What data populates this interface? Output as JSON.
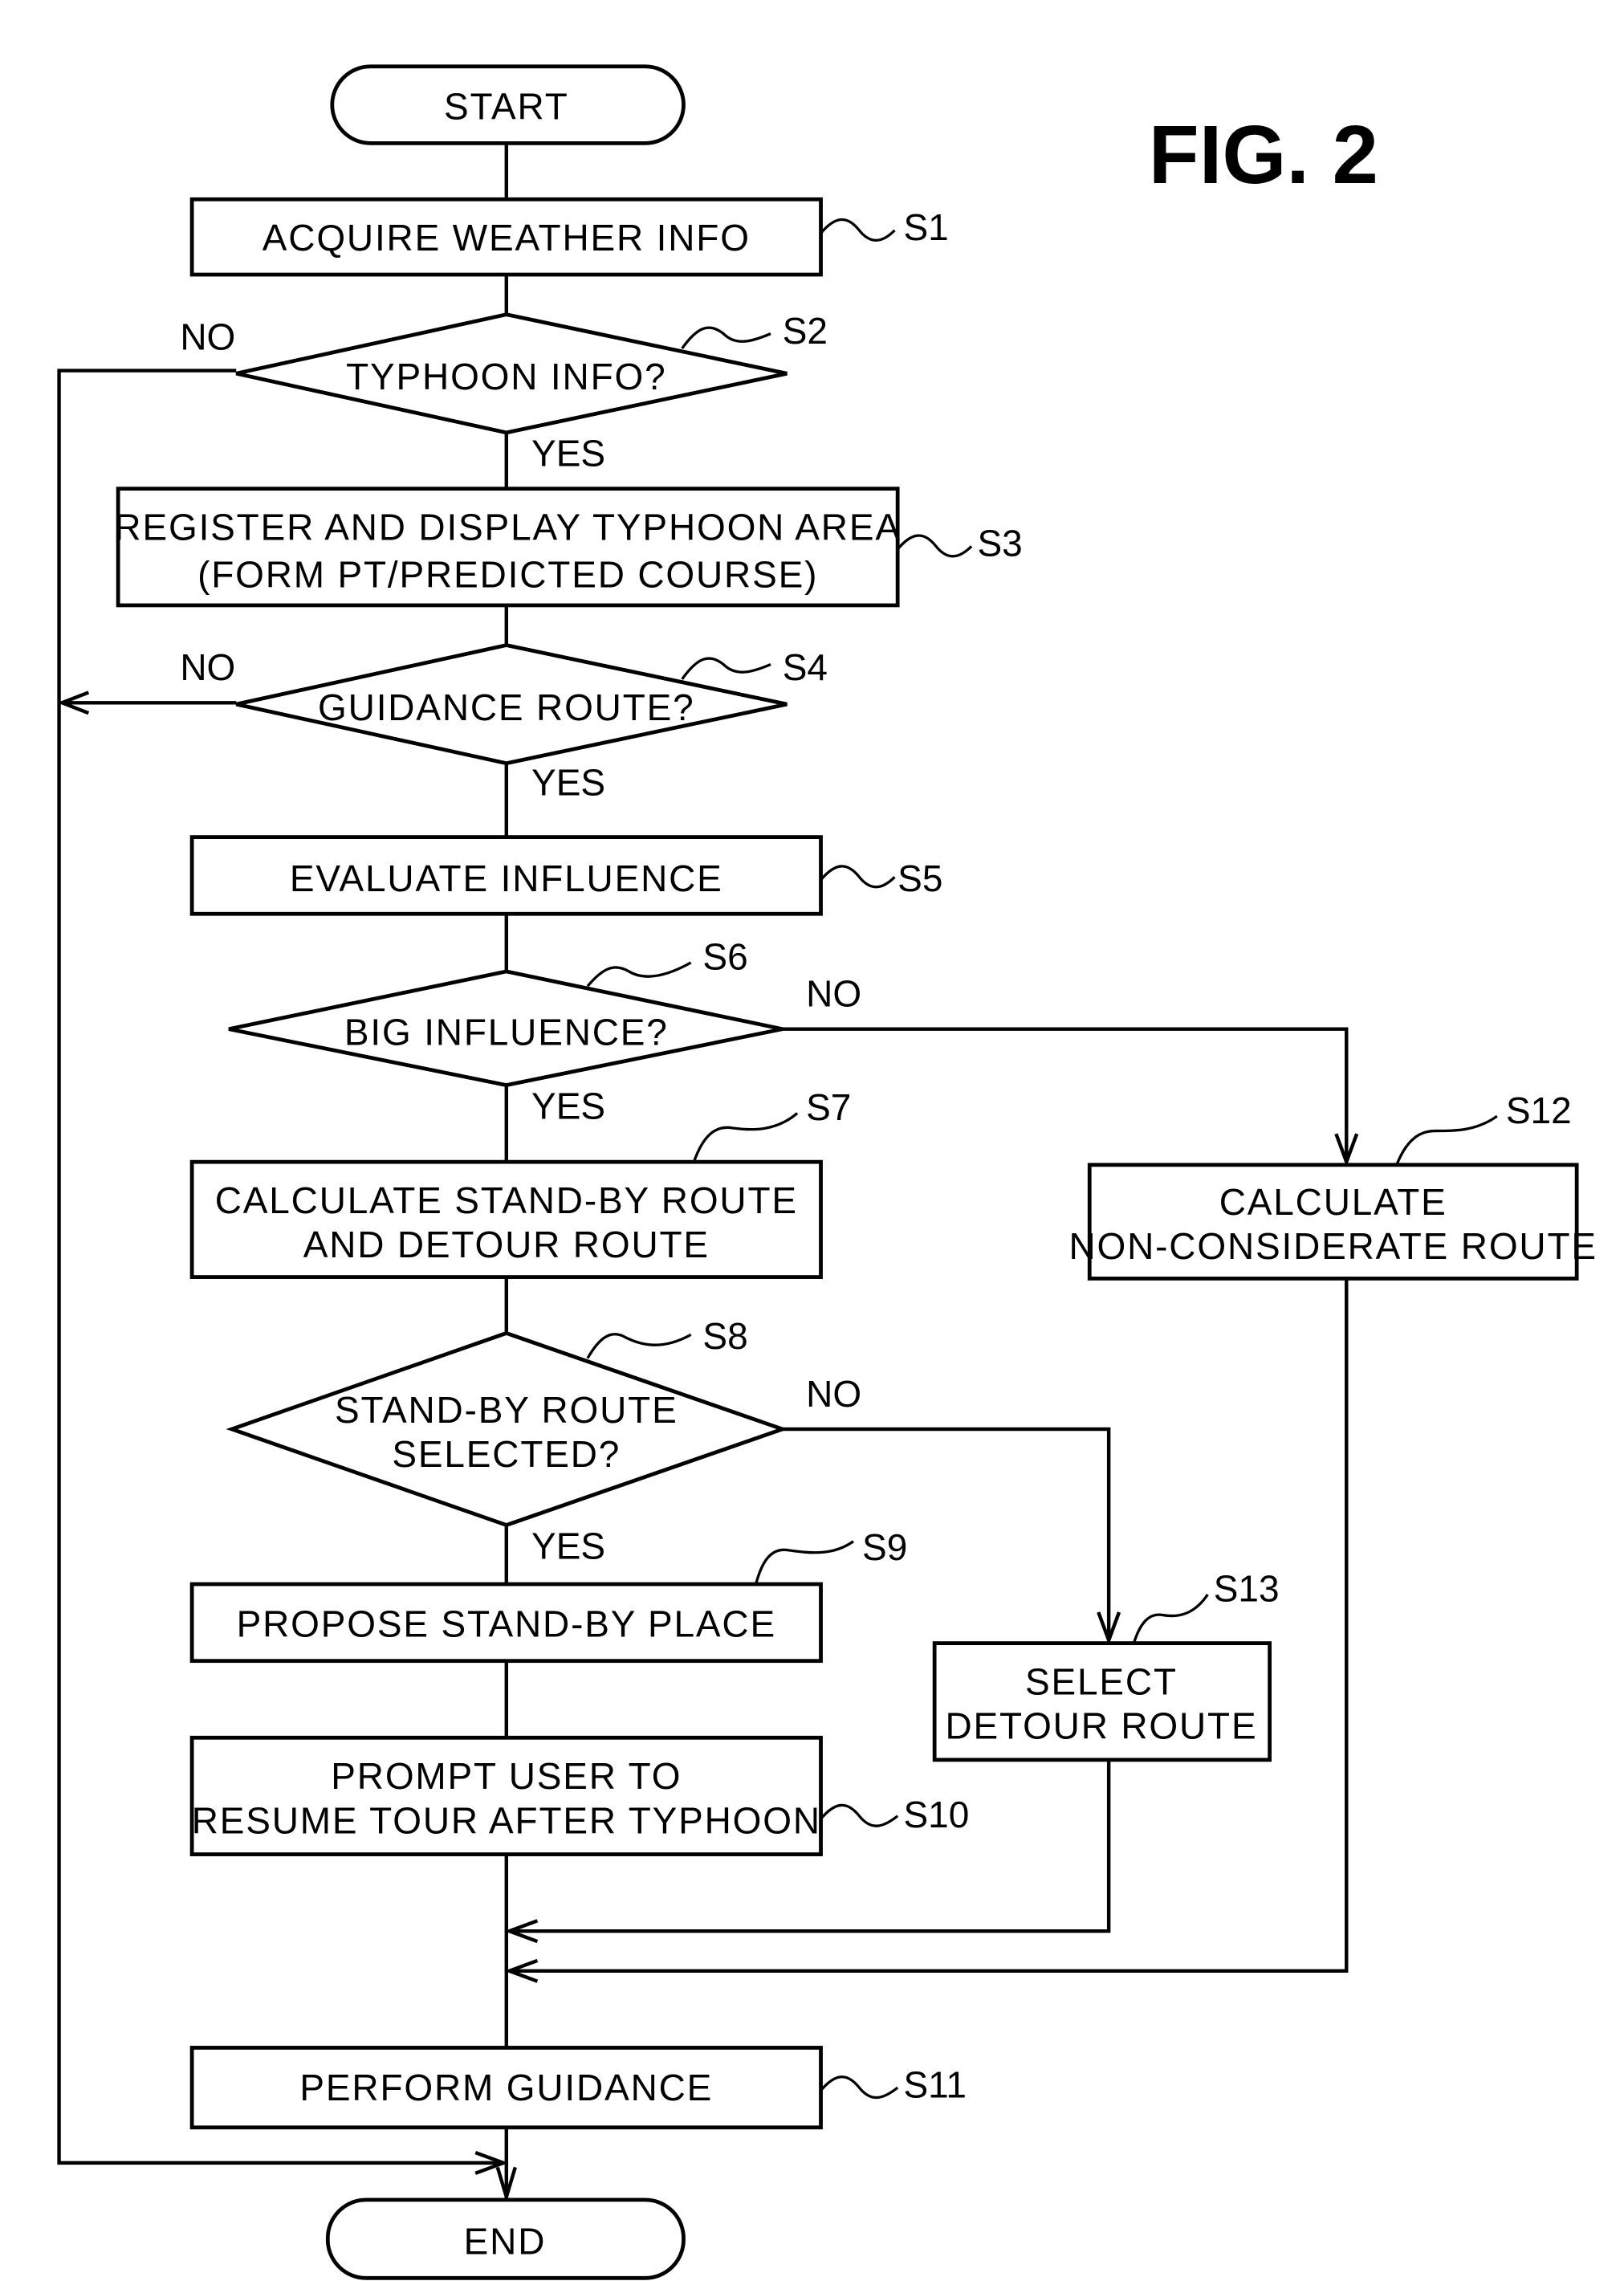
{
  "figure_label": "FIG. 2",
  "nodes": {
    "start": {
      "text": "START"
    },
    "s1": {
      "step": "S1",
      "lines": [
        "ACQUIRE WEATHER INFO"
      ]
    },
    "s2": {
      "step": "S2",
      "lines": [
        "TYPHOON INFO?"
      ],
      "yes": "YES",
      "no": "NO"
    },
    "s3": {
      "step": "S3",
      "lines": [
        "REGISTER AND DISPLAY TYPHOON AREA",
        "(FORM PT/PREDICTED COURSE)"
      ]
    },
    "s4": {
      "step": "S4",
      "lines": [
        "GUIDANCE ROUTE?"
      ],
      "yes": "YES",
      "no": "NO"
    },
    "s5": {
      "step": "S5",
      "lines": [
        "EVALUATE INFLUENCE"
      ]
    },
    "s6": {
      "step": "S6",
      "lines": [
        "BIG INFLUENCE?"
      ],
      "yes": "YES",
      "no": "NO"
    },
    "s7": {
      "step": "S7",
      "lines": [
        "CALCULATE STAND-BY ROUTE",
        "AND DETOUR ROUTE"
      ]
    },
    "s8": {
      "step": "S8",
      "lines": [
        "STAND-BY ROUTE",
        "SELECTED?"
      ],
      "yes": "YES",
      "no": "NO"
    },
    "s9": {
      "step": "S9",
      "lines": [
        "PROPOSE STAND-BY PLACE"
      ]
    },
    "s10": {
      "step": "S10",
      "lines": [
        "PROMPT USER TO",
        "RESUME TOUR AFTER TYPHOON"
      ]
    },
    "s11": {
      "step": "S11",
      "lines": [
        "PERFORM GUIDANCE"
      ]
    },
    "s12": {
      "step": "S12",
      "lines": [
        "CALCULATE",
        "NON-CONSIDERATE ROUTE"
      ]
    },
    "s13": {
      "step": "S13",
      "lines": [
        "SELECT",
        "DETOUR ROUTE"
      ]
    },
    "end": {
      "text": "END"
    }
  },
  "edges": [
    {
      "from": "start",
      "to": "s1"
    },
    {
      "from": "s1",
      "to": "s2"
    },
    {
      "from": "s2",
      "to": "s3",
      "label": "YES"
    },
    {
      "from": "s2",
      "to": "end",
      "label": "NO"
    },
    {
      "from": "s3",
      "to": "s4"
    },
    {
      "from": "s4",
      "to": "s5",
      "label": "YES"
    },
    {
      "from": "s4",
      "to": "end",
      "label": "NO"
    },
    {
      "from": "s5",
      "to": "s6"
    },
    {
      "from": "s6",
      "to": "s7",
      "label": "YES"
    },
    {
      "from": "s6",
      "to": "s12",
      "label": "NO"
    },
    {
      "from": "s7",
      "to": "s8"
    },
    {
      "from": "s8",
      "to": "s9",
      "label": "YES"
    },
    {
      "from": "s8",
      "to": "s13",
      "label": "NO"
    },
    {
      "from": "s9",
      "to": "s10"
    },
    {
      "from": "s10",
      "to": "s11"
    },
    {
      "from": "s13",
      "to": "s11"
    },
    {
      "from": "s12",
      "to": "s11"
    },
    {
      "from": "s11",
      "to": "end"
    }
  ]
}
